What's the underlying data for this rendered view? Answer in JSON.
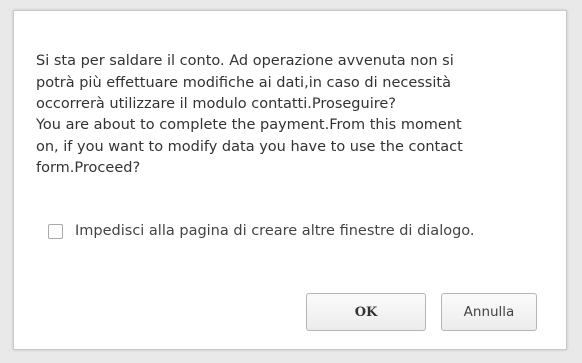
{
  "dialog": {
    "message_it": "Si sta per saldare il conto. Ad operazione avvenuta non si\npotrà più effettuare modifiche ai dati,in caso di necessità\noccorrerà utilizzare il modulo contatti.Proseguire?",
    "message_en": "You are about to complete the payment.From this moment\non, if you want to modify data you have to use the contact\nform.Proceed?",
    "suppress_label": "Impedisci alla pagina di creare altre finestre di dialogo.",
    "suppress_checked": false,
    "ok_label": "OK",
    "cancel_label": "Annulla"
  }
}
